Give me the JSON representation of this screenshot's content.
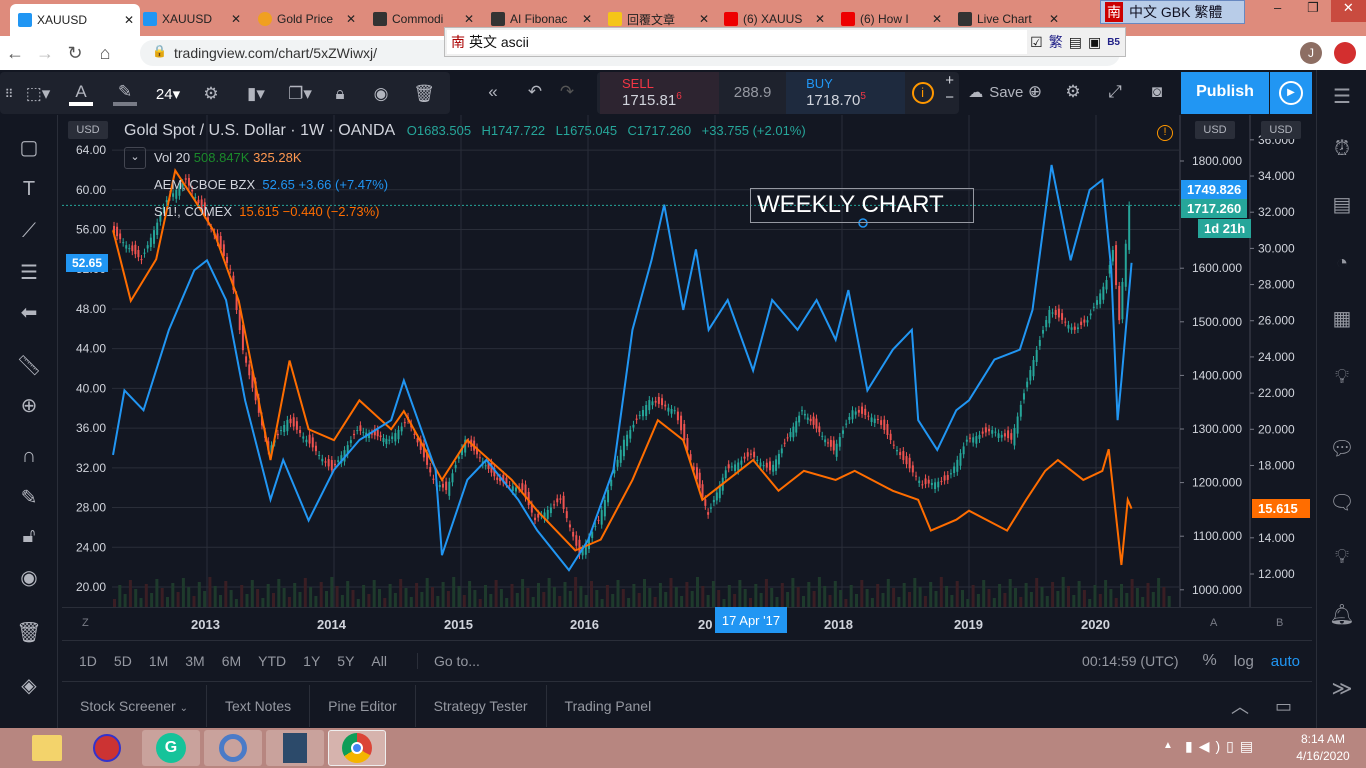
{
  "browser": {
    "tabs": [
      {
        "label": "XAUUSD",
        "active": true
      },
      {
        "label": "XAUUSD"
      },
      {
        "label": "Gold Price"
      },
      {
        "label": "Commodi"
      },
      {
        "label": "AI Fibonac"
      },
      {
        "label": "回覆文章"
      },
      {
        "label": "(6) XAUUS"
      },
      {
        "label": "(6) How I"
      },
      {
        "label": "Live Chart"
      }
    ],
    "url": "tradingview.com/chart/5xZWiwxj/",
    "ime_status": "中文 GBK 繁體",
    "ime_input": "英文 ascii",
    "ime_char": "南",
    "ime_trad": "繁",
    "ime_b5": "B5",
    "profile_initial": "J"
  },
  "toolbar": {
    "font_size": "24",
    "sell_label": "SELL",
    "sell_price_main": "1715.81",
    "sell_price_sup": "6",
    "spread": "288.9",
    "buy_label": "BUY",
    "buy_price_main": "1718.70",
    "buy_price_sup": "5",
    "save_label": "Save",
    "publish_label": "Publish"
  },
  "legend": {
    "title": "Gold Spot / U.S. Dollar · 1W · OANDA",
    "ohlc": {
      "o": "O1683.505",
      "h": "H1747.722",
      "l": "L1675.045",
      "c": "C1717.260",
      "chg": "+33.755 (+2.01%)"
    },
    "vol": {
      "label": "Vol 20",
      "v1": "508.847K",
      "v2": "325.28K"
    },
    "aem": {
      "label": "AEM, CBOE BZX",
      "value": "52.65 +3.66 (+7.47%)"
    },
    "si": {
      "label": "SI1!, COMEX",
      "value": "15.615 −0.440 (−2.73%)"
    },
    "annotation": "WEEKLY CHART"
  },
  "axes": {
    "currency": "USD",
    "scale_a": "A",
    "scale_b": "B",
    "scale_z": "Z"
  },
  "price_tags": {
    "aem": "52.65",
    "gold_high": "1749.826",
    "gold_last": "1717.260",
    "countdown": "1d 21h",
    "silver": "15.615"
  },
  "time_axis": {
    "crosshair_label": "17 Apr '17",
    "clipped_label": "20"
  },
  "range_bar": {
    "ranges": [
      "1D",
      "5D",
      "1M",
      "3M",
      "6M",
      "YTD",
      "1Y",
      "5Y",
      "All"
    ],
    "goto": "Go to...",
    "clock": "00:14:59 (UTC)",
    "percent": "%",
    "log": "log",
    "auto": "auto"
  },
  "bottom_tabs": [
    "Stock Screener",
    "Text Notes",
    "Pine Editor",
    "Strategy Tester",
    "Trading Panel"
  ],
  "taskbar": {
    "time": "8:14 AM",
    "date": "4/16/2020"
  },
  "colors": {
    "gold_up": "#26a69a",
    "gold_down": "#ef5350",
    "aem": "#2196f3",
    "silver": "#ff6d00",
    "accent": "#2196f3"
  },
  "chart_data": {
    "type": "line",
    "title": "Gold Spot / U.S. Dollar · 1W · OANDA",
    "x_ticks": [
      "2013",
      "2014",
      "2015",
      "2016",
      "2018",
      "2019",
      "2020"
    ],
    "axis_left": {
      "series": "AEM",
      "ticks": [
        "64.00",
        "60.00",
        "56.00",
        "52.00",
        "48.00",
        "44.00",
        "40.00",
        "36.00",
        "32.00",
        "28.00",
        "24.00",
        "20.00"
      ],
      "range": [
        20,
        64
      ]
    },
    "axis_a": {
      "series": "Gold",
      "ticks": [
        "1800.000",
        "1600.000",
        "1500.000",
        "1400.000",
        "1300.000",
        "1200.000",
        "1100.000",
        "1000.000"
      ],
      "range": [
        1000,
        1800
      ]
    },
    "axis_b": {
      "series": "Silver",
      "ticks": [
        "36.000",
        "34.000",
        "32.000",
        "30.000",
        "28.000",
        "26.000",
        "24.000",
        "22.000",
        "20.000",
        "18.000",
        "14.000",
        "12.000"
      ],
      "range": [
        12,
        34
      ]
    },
    "series": [
      {
        "name": "Gold (XAUUSD)",
        "axis": "a",
        "style": "candles",
        "points": [
          [
            2012.26,
            1671
          ],
          [
            2012.5,
            1615
          ],
          [
            2012.7,
            1727
          ],
          [
            2012.85,
            1765
          ],
          [
            2013.0,
            1700
          ],
          [
            2013.2,
            1597
          ],
          [
            2013.3,
            1447
          ],
          [
            2013.5,
            1260
          ],
          [
            2013.65,
            1317
          ],
          [
            2013.8,
            1280
          ],
          [
            2014.0,
            1223
          ],
          [
            2014.2,
            1298
          ],
          [
            2014.45,
            1280
          ],
          [
            2014.6,
            1317
          ],
          [
            2014.8,
            1205
          ],
          [
            2014.9,
            1186
          ],
          [
            2015.05,
            1280
          ],
          [
            2015.3,
            1205
          ],
          [
            2015.5,
            1186
          ],
          [
            2015.6,
            1130
          ],
          [
            2015.8,
            1168
          ],
          [
            2015.95,
            1065
          ],
          [
            2016.1,
            1130
          ],
          [
            2016.3,
            1280
          ],
          [
            2016.5,
            1354
          ],
          [
            2016.7,
            1335
          ],
          [
            2016.85,
            1223
          ],
          [
            2016.96,
            1140
          ],
          [
            2017.1,
            1223
          ],
          [
            2017.3,
            1252
          ],
          [
            2017.45,
            1223
          ],
          [
            2017.7,
            1335
          ],
          [
            2017.95,
            1260
          ],
          [
            2018.1,
            1335
          ],
          [
            2018.3,
            1317
          ],
          [
            2018.5,
            1242
          ],
          [
            2018.65,
            1196
          ],
          [
            2018.85,
            1205
          ],
          [
            2019.0,
            1280
          ],
          [
            2019.2,
            1298
          ],
          [
            2019.35,
            1280
          ],
          [
            2019.5,
            1410
          ],
          [
            2019.65,
            1522
          ],
          [
            2019.85,
            1485
          ],
          [
            2019.95,
            1503
          ],
          [
            2020.1,
            1578
          ],
          [
            2020.15,
            1634
          ],
          [
            2020.2,
            1503
          ],
          [
            2020.28,
            1717
          ]
        ]
      },
      {
        "name": "AEM",
        "axis": "left",
        "style": "line",
        "points": [
          [
            2012.26,
            33.3
          ],
          [
            2012.35,
            39.8
          ],
          [
            2012.5,
            37.8
          ],
          [
            2012.7,
            45.9
          ],
          [
            2012.9,
            51.9
          ],
          [
            2013.0,
            52.9
          ],
          [
            2013.15,
            48.9
          ],
          [
            2013.3,
            38.8
          ],
          [
            2013.5,
            28.8
          ],
          [
            2013.6,
            32.8
          ],
          [
            2013.8,
            26.7
          ],
          [
            2014.0,
            31.8
          ],
          [
            2014.2,
            34.8
          ],
          [
            2014.45,
            36.8
          ],
          [
            2014.55,
            40.8
          ],
          [
            2014.8,
            31.8
          ],
          [
            2014.85,
            23.2
          ],
          [
            2015.05,
            30.8
          ],
          [
            2015.2,
            32.8
          ],
          [
            2015.45,
            28.8
          ],
          [
            2015.6,
            25.7
          ],
          [
            2015.85,
            21.7
          ],
          [
            2016.0,
            24.7
          ],
          [
            2016.2,
            31.8
          ],
          [
            2016.35,
            45.9
          ],
          [
            2016.5,
            52.9
          ],
          [
            2016.6,
            58.5
          ],
          [
            2016.75,
            47.9
          ],
          [
            2016.85,
            54
          ],
          [
            2016.95,
            45.9
          ],
          [
            2017.1,
            48.9
          ],
          [
            2017.3,
            41.8
          ],
          [
            2017.45,
            48.9
          ],
          [
            2017.65,
            45.9
          ],
          [
            2017.8,
            48.9
          ],
          [
            2017.95,
            44.9
          ],
          [
            2018.05,
            49.9
          ],
          [
            2018.2,
            39.8
          ],
          [
            2018.4,
            43.9
          ],
          [
            2018.55,
            45.9
          ],
          [
            2018.6,
            36.8
          ],
          [
            2018.75,
            33.8
          ],
          [
            2018.9,
            37.8
          ],
          [
            2019.0,
            38.8
          ],
          [
            2019.2,
            42.9
          ],
          [
            2019.4,
            43.9
          ],
          [
            2019.5,
            47.9
          ],
          [
            2019.65,
            62.5
          ],
          [
            2019.8,
            52.9
          ],
          [
            2019.95,
            60
          ],
          [
            2020.05,
            61
          ],
          [
            2020.12,
            52
          ],
          [
            2020.17,
            36.8
          ],
          [
            2020.2,
            40.8
          ],
          [
            2020.28,
            52.65
          ]
        ]
      },
      {
        "name": "Silver (SI1!)",
        "axis": "b",
        "style": "line",
        "points": [
          [
            2012.26,
            31
          ],
          [
            2012.4,
            27.1
          ],
          [
            2012.6,
            29.4
          ],
          [
            2012.75,
            34.3
          ],
          [
            2012.9,
            32.7
          ],
          [
            2013.05,
            31
          ],
          [
            2013.25,
            27.1
          ],
          [
            2013.5,
            18.3
          ],
          [
            2013.65,
            23.8
          ],
          [
            2013.8,
            20
          ],
          [
            2014.0,
            19.4
          ],
          [
            2014.2,
            21.6
          ],
          [
            2014.45,
            20
          ],
          [
            2014.55,
            21
          ],
          [
            2014.85,
            17.2
          ],
          [
            2015.05,
            19.4
          ],
          [
            2015.4,
            17.2
          ],
          [
            2015.6,
            15.5
          ],
          [
            2015.9,
            13.3
          ],
          [
            2016.1,
            13.9
          ],
          [
            2016.35,
            17.2
          ],
          [
            2016.55,
            20.5
          ],
          [
            2016.75,
            19.4
          ],
          [
            2016.9,
            16.1
          ],
          [
            2017.1,
            17.2
          ],
          [
            2017.3,
            18.3
          ],
          [
            2017.5,
            16.6
          ],
          [
            2017.7,
            17.7
          ],
          [
            2017.95,
            17.2
          ],
          [
            2018.1,
            17.7
          ],
          [
            2018.4,
            16.6
          ],
          [
            2018.6,
            16.1
          ],
          [
            2018.7,
            14.4
          ],
          [
            2018.9,
            15
          ],
          [
            2019.0,
            15.5
          ],
          [
            2019.3,
            14.4
          ],
          [
            2019.45,
            16.1
          ],
          [
            2019.6,
            17.7
          ],
          [
            2019.7,
            18.3
          ],
          [
            2019.9,
            17.2
          ],
          [
            2020.05,
            17.7
          ],
          [
            2020.1,
            18.9
          ],
          [
            2020.2,
            12.5
          ],
          [
            2020.25,
            16.1
          ],
          [
            2020.28,
            15.615
          ]
        ]
      }
    ]
  }
}
